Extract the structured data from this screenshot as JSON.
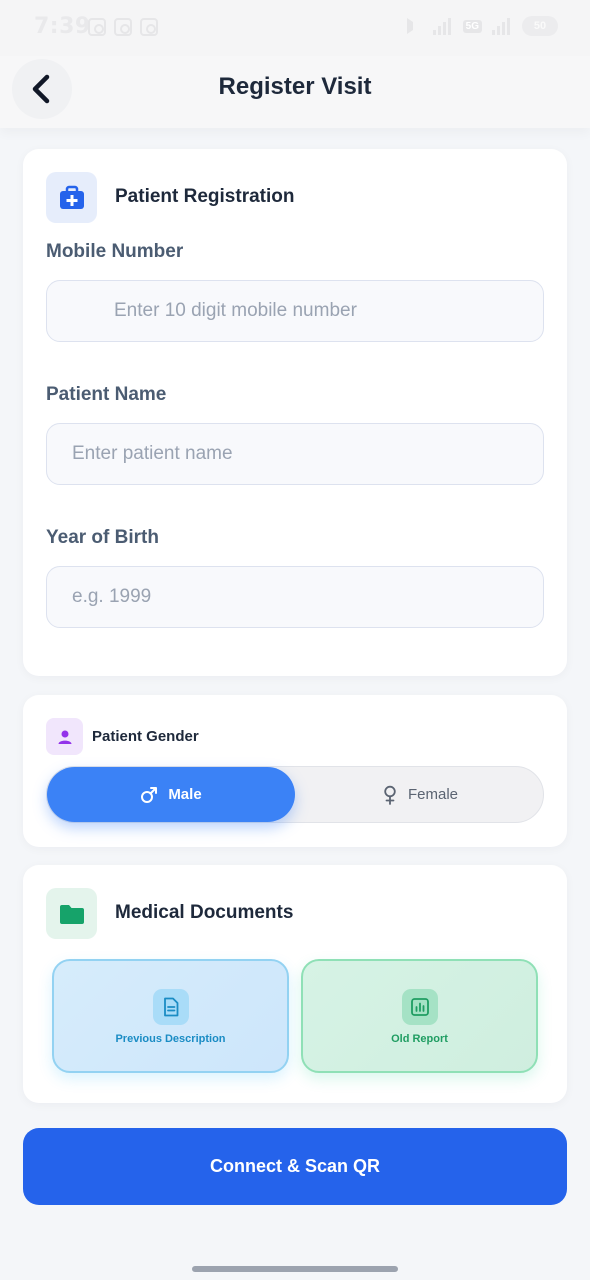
{
  "status_bar": {
    "time": "7:39",
    "battery": "50"
  },
  "header": {
    "title": "Register Visit"
  },
  "registration": {
    "title": "Patient Registration",
    "fields": [
      {
        "label": "Mobile Number",
        "placeholder": "Enter 10 digit mobile number"
      },
      {
        "label": "Patient Name",
        "placeholder": "Enter patient name"
      },
      {
        "label": "Year of Birth",
        "placeholder": "e.g. 1999"
      }
    ]
  },
  "gender": {
    "title": "Patient Gender",
    "options": [
      {
        "label": "Male",
        "selected": true
      },
      {
        "label": "Female",
        "selected": false
      }
    ]
  },
  "documents": {
    "title": "Medical Documents",
    "items": [
      {
        "label": "Previous Description",
        "icon": "document-icon"
      },
      {
        "label": "Old Report",
        "icon": "bar-chart-icon"
      }
    ]
  },
  "actions": {
    "primary": "Connect & Scan QR"
  },
  "colors": {
    "primary": "#2563eb",
    "toggle_active": "#3b82f6",
    "medical_icon": "#2563eb",
    "gender_icon": "#9333ea",
    "folder_icon": "#16a36a"
  }
}
